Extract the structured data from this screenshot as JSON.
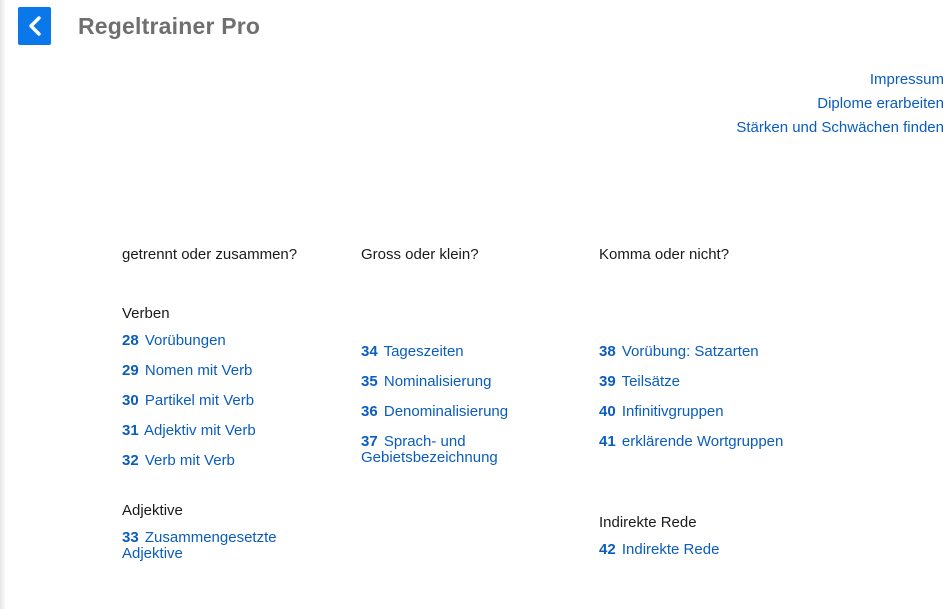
{
  "header": {
    "back_icon": "chevron-left-icon",
    "title": "Regeltrainer Pro",
    "accent_color": "#0a78e8"
  },
  "top_links": [
    {
      "label": "Impressum"
    },
    {
      "label": "Diplome erarbeiten"
    },
    {
      "label": "Stärken und Schwächen finden"
    }
  ],
  "columns": [
    {
      "heading": "getrennt oder zusammen?",
      "groups": [
        {
          "label": "Verben",
          "lessons": [
            {
              "num": "28",
              "title": "Vorübungen"
            },
            {
              "num": "29",
              "title": "Nomen mit Verb"
            },
            {
              "num": "30",
              "title": "Partikel mit Verb"
            },
            {
              "num": "31",
              "title": "Adjektiv mit Verb"
            },
            {
              "num": "32",
              "title": "Verb mit Verb"
            }
          ]
        },
        {
          "label": "Adjektive",
          "lessons": [
            {
              "num": "33",
              "title": "Zusammengesetzte Adjektive"
            }
          ]
        }
      ]
    },
    {
      "heading": "Gross oder klein?",
      "groups": [
        {
          "label": "",
          "lessons": [
            {
              "num": "34",
              "title": "Tageszeiten"
            },
            {
              "num": "35",
              "title": "Nominalisierung"
            },
            {
              "num": "36",
              "title": "Denominalisierung"
            },
            {
              "num": "37",
              "title": "Sprach- und Gebietsbezeichnung"
            }
          ]
        }
      ]
    },
    {
      "heading": "Komma oder nicht?",
      "groups": [
        {
          "label": "",
          "lessons": [
            {
              "num": "38",
              "title": "Vorübung: Satzarten"
            },
            {
              "num": "39",
              "title": "Teilsätze"
            },
            {
              "num": "40",
              "title": "Infinitivgruppen"
            },
            {
              "num": "41",
              "title": "erklärende Wortgruppen"
            }
          ]
        },
        {
          "label": "Indirekte Rede",
          "lessons": [
            {
              "num": "42",
              "title": "Indirekte Rede"
            }
          ]
        }
      ]
    }
  ]
}
